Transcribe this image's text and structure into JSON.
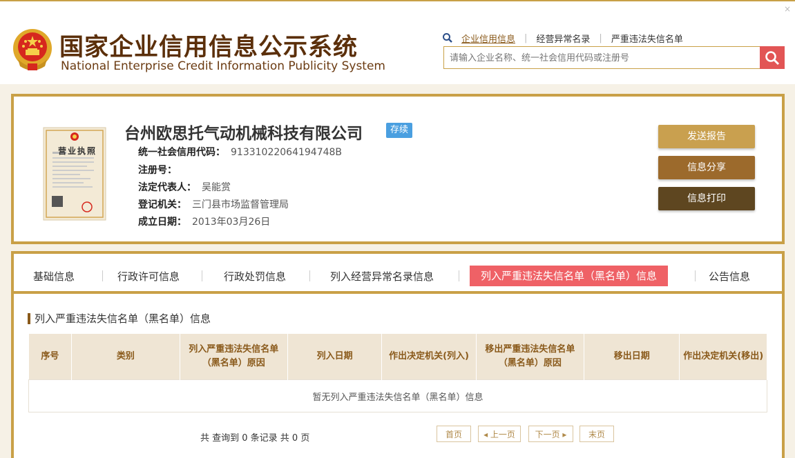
{
  "header": {
    "title_cn": "国家企业信用信息公示系统",
    "title_en": "National Enterprise Credit Information Publicity System",
    "close": "×",
    "search_links": [
      "企业信用信息",
      "经营异常名录",
      "严重违法失信名单"
    ],
    "search_placeholder": "请输入企业名称、统一社会信用代码或注册号"
  },
  "company": {
    "name": "台州欧思托气动机械科技有限公司",
    "status": "存续",
    "license_caption": "营业执照",
    "fields": [
      {
        "label": "统一社会信用代码：",
        "value": "91331022064194748B"
      },
      {
        "label": "注册号：",
        "value": ""
      },
      {
        "label": "法定代表人：",
        "value": "吴能赏"
      },
      {
        "label": "登记机关：",
        "value": "三门县市场监督管理局"
      },
      {
        "label": "成立日期：",
        "value": "2013年03月26日"
      }
    ],
    "buttons": [
      "发送报告",
      "信息分享",
      "信息打印"
    ]
  },
  "tabs": [
    "基础信息",
    "行政许可信息",
    "行政处罚信息",
    "列入经营异常名录信息",
    "列入严重违法失信名单（黑名单）信息",
    "公告信息"
  ],
  "section": {
    "title": "列入严重违法失信名单（黑名单）信息",
    "columns": [
      "序号",
      "类别",
      "列入严重违法失信名单（黑名单）原因",
      "列入日期",
      "作出决定机关(列入)",
      "移出严重违法失信名单（黑名单）原因",
      "移出日期",
      "作出决定机关(移出)"
    ],
    "empty_text": "暂无列入严重违法失信名单（黑名单）信息"
  },
  "pager": {
    "summary": "共 查询到 0 条记录 共 0 页",
    "first": "首页",
    "prev": "上一页",
    "next": "下一页",
    "last": "末页"
  },
  "colors": {
    "gold": "#c9a047",
    "brown": "#8a5a1b",
    "red": "#e25555",
    "tab_active": "#ef6166",
    "badge": "#4a9fe0",
    "btn_send": "#c9a04f",
    "btn_share": "#9c6a2c",
    "btn_print": "#5e4620"
  }
}
